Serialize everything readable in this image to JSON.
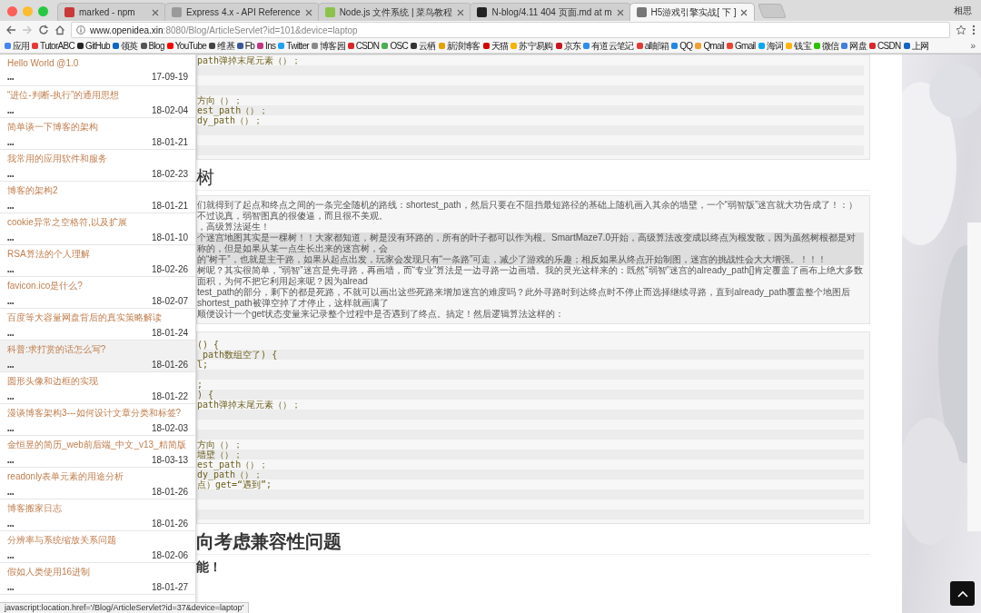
{
  "browser": {
    "tabs": [
      {
        "title": "marked - npm",
        "selected": false,
        "color": "#cb3837"
      },
      {
        "title": "Express 4.x - API Reference",
        "selected": false,
        "color": "#9a9a9a"
      },
      {
        "title": "Node.js 文件系统 | 菜鸟教程",
        "selected": false,
        "color": "#8bc34a"
      },
      {
        "title": "N-blog/4.11 404 页面.md at m",
        "selected": false,
        "color": "#222222"
      },
      {
        "title": "H5游戏引擎实战[ 下 ]",
        "selected": true,
        "color": "#777777"
      }
    ],
    "profile": "相思",
    "forward": {
      "disabled": true
    },
    "url": {
      "host": "www.openidea.xin",
      "path": ":8080/Blog/ArticleServlet?id=101&device=laptop"
    },
    "bookmarks": [
      {
        "label": "应用",
        "color": "#4285f4"
      },
      {
        "label": "TutorABC",
        "color": "#e53935"
      },
      {
        "label": "GitHub",
        "color": "#222222"
      },
      {
        "label": "领英",
        "color": "#0a66c2"
      },
      {
        "label": "Blog",
        "color": "#555555"
      },
      {
        "label": "YouTube",
        "color": "#ff0000"
      },
      {
        "label": "维基",
        "color": "#444444"
      },
      {
        "label": "Fb",
        "color": "#3b5998"
      },
      {
        "label": "Ins",
        "color": "#c13584"
      },
      {
        "label": "Twitter",
        "color": "#1da1f2"
      },
      {
        "label": "博客园",
        "color": "#8a8a8a"
      },
      {
        "label": "CSDN",
        "color": "#d9262c"
      },
      {
        "label": "OSC",
        "color": "#4caf50"
      },
      {
        "label": "云栖",
        "color": "#333333"
      },
      {
        "label": "新浪博客",
        "color": "#e6a100"
      },
      {
        "label": "天猫",
        "color": "#d50000"
      },
      {
        "label": "苏宁易购",
        "color": "#f5b400"
      },
      {
        "label": "京东",
        "color": "#c91623"
      },
      {
        "label": "有道云笔记",
        "color": "#2d8cf0"
      },
      {
        "label": "all邮箱",
        "color": "#e53935"
      },
      {
        "label": "QQ",
        "color": "#1e88e5"
      },
      {
        "label": "Qmail",
        "color": "#f0a030"
      },
      {
        "label": "Gmail",
        "color": "#ea4335"
      },
      {
        "label": "海词",
        "color": "#03a9f4"
      },
      {
        "label": "钱宝",
        "color": "#ffb300"
      },
      {
        "label": "微信",
        "color": "#2dc100"
      },
      {
        "label": "网盘",
        "color": "#3f7fe0"
      },
      {
        "label": "CSDN",
        "color": "#d9262c"
      },
      {
        "label": "上网",
        "color": "#1565c0"
      }
    ],
    "overflow": "»"
  },
  "sidebar": {
    "items": [
      {
        "title": "Hello World @1.0",
        "dots": "•••",
        "date": "17-09-19",
        "selected": false
      },
      {
        "title": "“进位-判断-执行”的通用思想",
        "dots": "•••",
        "date": "18-02-04",
        "selected": false
      },
      {
        "title": "简单谈一下博客的架构",
        "dots": "•••",
        "date": "18-01-21",
        "selected": false
      },
      {
        "title": "我常用的应用软件和服务",
        "dots": "•••",
        "date": "18-02-23",
        "selected": false
      },
      {
        "title": "博客的架构2",
        "dots": "•••",
        "date": "18-01-21",
        "selected": false
      },
      {
        "title": "cookie异常之空格符,以及扩展",
        "dots": "•••",
        "date": "18-01-10",
        "selected": false
      },
      {
        "title": "RSA算法的个人理解",
        "dots": "•••",
        "date": "18-02-26",
        "selected": false
      },
      {
        "title": "favicon.ico是什么?",
        "dots": "•••",
        "date": "18-02-07",
        "selected": false
      },
      {
        "title": "百度等大容量网盘背后的真实策略解读",
        "dots": "•••",
        "date": "18-01-24",
        "selected": false
      },
      {
        "title": "科普:求打赏的话怎么写?",
        "dots": "•••",
        "date": "18-01-26",
        "selected": true
      },
      {
        "title": "圆形头像和边框的实现",
        "dots": "•••",
        "date": "18-01-22",
        "selected": false
      },
      {
        "title": "漫谈博客架构3---如何设计文章分类和标签?",
        "dots": "•••",
        "date": "18-02-03",
        "selected": false
      },
      {
        "title": "金恒昱的简历_web前后端_中文_v13_精简版",
        "dots": "•••",
        "date": "18-03-13",
        "selected": false
      },
      {
        "title": "readonly表单元素的用途分析",
        "dots": "•••",
        "date": "18-01-26",
        "selected": false
      },
      {
        "title": "博客搬家日志",
        "dots": "•••",
        "date": "18-01-26",
        "selected": false
      },
      {
        "title": "分辨率与系统缩放关系问题",
        "dots": "•••",
        "date": "18-02-06",
        "selected": false
      },
      {
        "title": "假如人类使用16进制",
        "dots": "•••",
        "date": "18-01-27",
        "selected": false
      }
    ]
  },
  "article": {
    "blocks": [
      {
        "kind": "code",
        "lines": [
          {
            "kind": "code",
            "text": "path弹掉末尾元素（）；"
          },
          {
            "kind": "blank"
          },
          {
            "kind": "blank"
          },
          {
            "kind": "blank"
          },
          {
            "kind": "code",
            "text": "方向（）；"
          },
          {
            "kind": "code",
            "text": "est_path（）；"
          },
          {
            "kind": "code",
            "text": "dy_path（）；"
          },
          {
            "kind": "blank"
          },
          {
            "kind": "blank"
          },
          {
            "kind": "blank"
          }
        ]
      },
      {
        "kind": "heading",
        "text": "树"
      },
      {
        "kind": "paragraph",
        "lines": [
          {
            "text": "们就得到了起点和终点之间的一条完全随机的路线：shortest_path，然后只要在不阻挡最短路径的基础上随机画入其余的墙壁，一个“弱智版”迷宫就大功告成了！：）不过说真，弱智图真的很傻逼，而且很不美观。",
            "highlighted": false
          },
          {
            "text": "，高级算法诞生！",
            "highlighted": false
          },
          {
            "text": "个迷宫地图其实是一棵树！！大家都知道，树是没有环路的，所有的叶子都可以作为根。SmartMaze7.0开始，高级算法改变成以终点为根发散，因为虽然树根都是对称的，但是如果从某一点生长出来的迷宫树，会",
            "highlighted": true
          },
          {
            "text": "的“树干”，也就是主干路，如果从起点出发，玩家会发现只有“一条路”可走，减少了游戏的乐趣；相反如果从终点开始制图，迷宫的挑战性会大大增强。！！！",
            "highlighted": true
          },
          {
            "text": "树呢？其实很简单，“弱智”迷宫是先寻路，再画墙，而“专业”算法是一边寻路一边画墙。我的灵光这样来的：既然“弱智”迷宫的already_path[]肯定覆盖了画布上绝大多数面积，为何不把它利用起来呢？因为alread",
            "highlighted": false
          },
          {
            "text": "test_path的部分，剩下的都是死路，不就可以画出这些死路来增加迷宫的难度吗？此外寻路时到达终点时不停止而选择继续寻路，直到already_path覆盖整个地图后shortest_path被弹空掉了才停止，这样就画满了",
            "highlighted": false
          },
          {
            "text": "顺便设计一个get状态变量来记录整个过程中是否遇到了终点。搞定！然后逻辑算法这样的：",
            "highlighted": false
          }
        ]
      },
      {
        "kind": "code",
        "lines": [
          {
            "kind": "code",
            "text": "() {"
          },
          {
            "kind": "code",
            "text": "_path数组空了) {"
          },
          {
            "kind": "code",
            "text": "l;"
          },
          {
            "kind": "blank"
          },
          {
            "kind": "code",
            "text": ";"
          },
          {
            "kind": "code",
            "text": ") {"
          },
          {
            "kind": "code",
            "text": "path弹掉末尾元素（）；"
          },
          {
            "kind": "blank"
          },
          {
            "kind": "blank"
          },
          {
            "kind": "blank"
          },
          {
            "kind": "code",
            "text": "方向（）；"
          },
          {
            "kind": "code",
            "text": "墙壁（）；"
          },
          {
            "kind": "code",
            "text": "est_path（）；"
          },
          {
            "kind": "code",
            "text": "dy_path（）；"
          },
          {
            "kind": "code",
            "text": "点）get=“遇到”;"
          },
          {
            "kind": "blank"
          },
          {
            "kind": "blank"
          },
          {
            "kind": "blank"
          }
        ]
      },
      {
        "kind": "heading",
        "text": "向考虑兼容性问题"
      },
      {
        "kind": "subheading",
        "text": "能！"
      }
    ]
  },
  "status_bar": "javascript:location.href='/Blog/ArticleServlet?id=37&device=laptop'"
}
